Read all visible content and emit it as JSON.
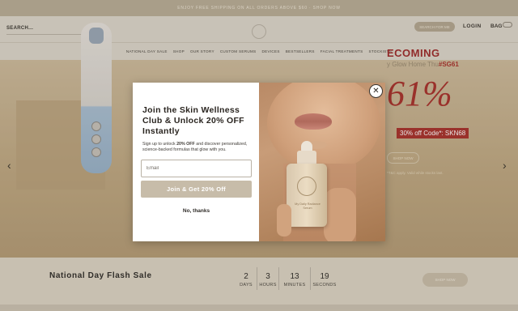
{
  "announcement": "ENJOY FREE SHIPPING ON ALL ORDERS ABOVE $60 · SHOP NOW",
  "header": {
    "search_label": "SEARCH...",
    "search_button": "SEARCH FOR ME",
    "login": "LOGIN",
    "bag": "BAG"
  },
  "nav": {
    "items": [
      "NATIONAL DAY SALE",
      "SHOP",
      "OUR STORY",
      "CUSTOM SERUMS",
      "DEVICES",
      "BESTSELLERS",
      "FACIAL TREATMENTS",
      "STOCKISTS"
    ]
  },
  "hero": {
    "heading": "ECOMING",
    "subline_prefix": "y Glow Home Thu",
    "subline_tag": "#SG61",
    "percent": "61%",
    "code_text": "30% off Code*: SKN68",
    "shop_button": "SHOP NOW",
    "fine_print": "*T&C apply. Valid while stocks last."
  },
  "flash": {
    "title": "National Day Flash Sale",
    "countdown": [
      {
        "value": "2",
        "label": "DAYS"
      },
      {
        "value": "3",
        "label": "HOURS"
      },
      {
        "value": "13",
        "label": "MINUTES"
      },
      {
        "value": "19",
        "label": "SECONDS"
      }
    ],
    "shop_button": "SHOP NOW"
  },
  "modal": {
    "title": "Join the Skin Wellness Club & Unlock 20% OFF Instantly",
    "desc_prefix": "Sign up to unlock ",
    "desc_bold": "20% OFF",
    "desc_suffix": " and discover personalized, science-backed formulas that glow with you.",
    "email_placeholder": "Email",
    "join_button": "Join & Get 20% Off",
    "decline_button": "No, thanks",
    "close_symbol": "✕",
    "bottle_label": "My Daily Radiance Serum"
  }
}
